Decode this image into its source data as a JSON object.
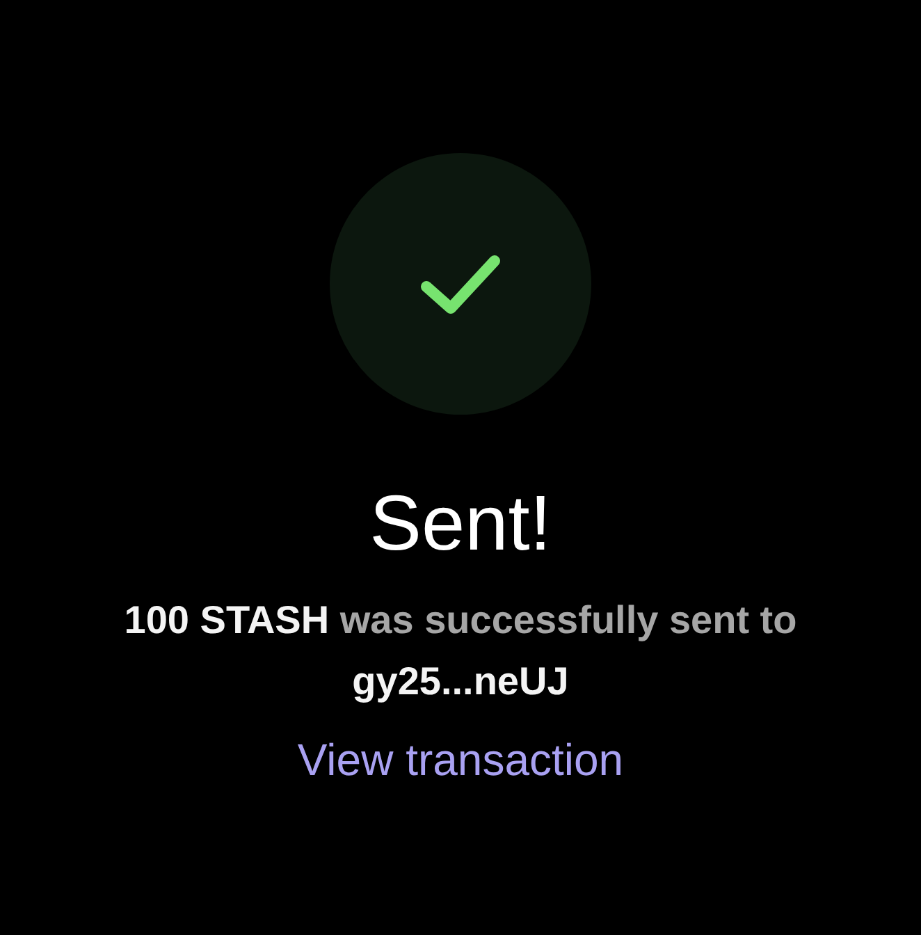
{
  "status": {
    "kind": "success"
  },
  "title": "Sent!",
  "message": {
    "amount": "100 STASH",
    "text": "was successfully sent to",
    "recipient": "gy25...neUJ"
  },
  "link": {
    "label": "View transaction"
  }
}
